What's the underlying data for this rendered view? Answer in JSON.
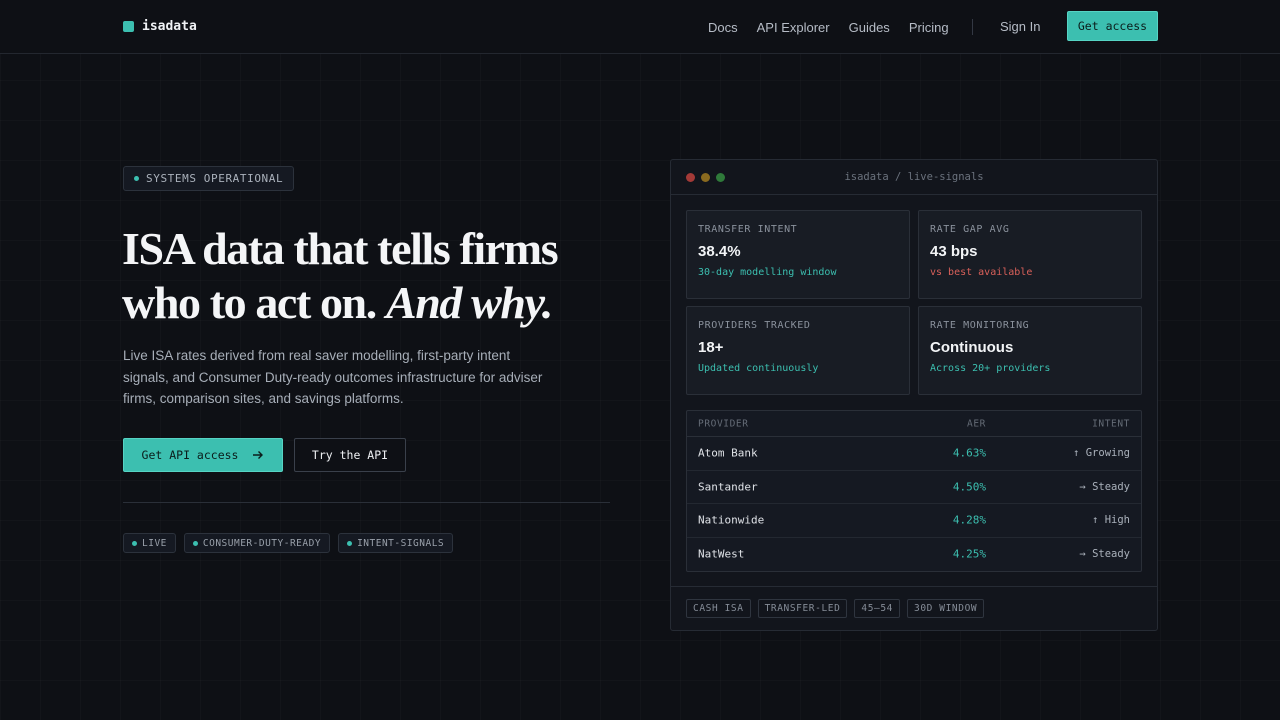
{
  "nav": {
    "logo_text": "isadata",
    "links": [
      "Docs",
      "API Explorer",
      "Guides",
      "Pricing"
    ],
    "signin": "Sign In",
    "cta": "Get access"
  },
  "hero": {
    "status": "SYSTEMS OPERATIONAL",
    "headline_main": "ISA data that tells firms who to act on.",
    "headline_em": "And why.",
    "subtext": "Live ISA rates derived from real saver modelling, first-party intent signals, and Consumer Duty-ready outcomes infrastructure for adviser firms, comparison sites, and savings platforms.",
    "primary_button": "Get API access",
    "secondary_button": "Try the API",
    "tags": [
      "LIVE",
      "CONSUMER-DUTY-READY",
      "INTENT-SIGNALS"
    ]
  },
  "panel": {
    "title": "isadata / live-signals",
    "stats": [
      {
        "label": "TRANSFER INTENT",
        "value": "38.4%",
        "note": "30-day modelling window",
        "note_color": "#3cbfb0"
      },
      {
        "label": "RATE GAP AVG",
        "value": "43 bps",
        "note": "vs best available",
        "note_color": "#d9605a"
      },
      {
        "label": "PROVIDERS TRACKED",
        "value": "18+",
        "note": "Updated continuously",
        "note_color": "#3cbfb0"
      },
      {
        "label": "RATE MONITORING",
        "value": "Continuous",
        "note": "Across 20+ providers",
        "note_color": "#3cbfb0"
      }
    ],
    "table": {
      "headers": [
        "PROVIDER",
        "AER",
        "INTENT"
      ],
      "rows": [
        {
          "provider": "Atom Bank",
          "aer": "4.63%",
          "intent": "↑ Growing"
        },
        {
          "provider": "Santander",
          "aer": "4.50%",
          "intent": "→ Steady"
        },
        {
          "provider": "Nationwide",
          "aer": "4.28%",
          "intent": "↑ High"
        },
        {
          "provider": "NatWest",
          "aer": "4.25%",
          "intent": "→ Steady"
        }
      ]
    },
    "footer_tags": [
      "CASH ISA",
      "TRANSFER-LED",
      "45–54",
      "30D WINDOW"
    ]
  },
  "colors": {
    "accent": "#3cbfb0",
    "negative": "#d9605a",
    "background": "#0e1015"
  }
}
